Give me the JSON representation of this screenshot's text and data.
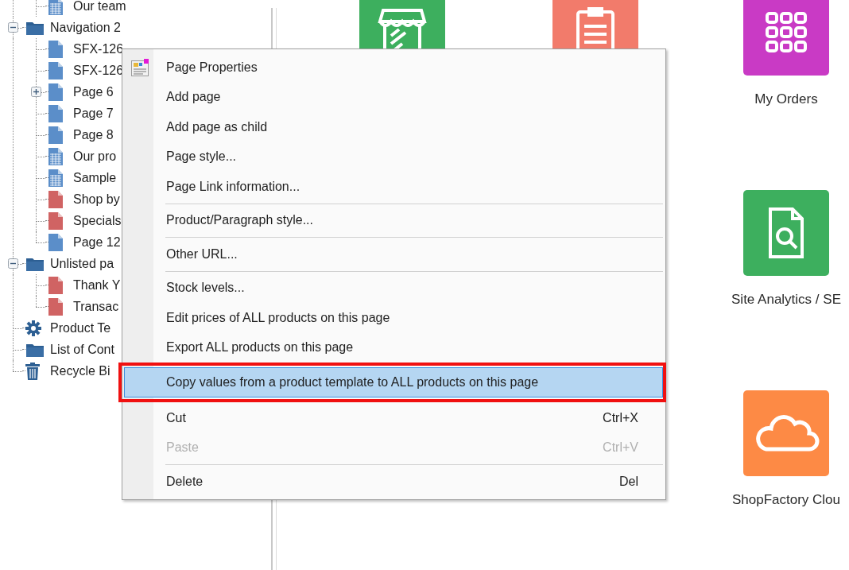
{
  "tree_continued": [
    {
      "label": "Our team",
      "kind": "grid-page"
    }
  ],
  "tree": [
    {
      "label": "Navigation 2",
      "kind": "folder",
      "expanded": true,
      "children": [
        {
          "label": "SFX-126",
          "kind": "page"
        },
        {
          "label": "SFX-126",
          "kind": "page"
        },
        {
          "label": "Page 6",
          "kind": "page",
          "expanded": false
        },
        {
          "label": "Page 7",
          "kind": "page"
        },
        {
          "label": "Page 8",
          "kind": "page"
        },
        {
          "label": "Our pro",
          "kind": "grid-page"
        },
        {
          "label": "Sample",
          "kind": "grid-page"
        },
        {
          "label": "Shop by",
          "kind": "red-page"
        },
        {
          "label": "Specials",
          "kind": "red-page"
        },
        {
          "label": "Page 12",
          "kind": "page"
        }
      ]
    },
    {
      "label": "Unlisted pa",
      "kind": "folder",
      "expanded": true,
      "children": [
        {
          "label": "Thank Y",
          "kind": "red-page"
        },
        {
          "label": "Transac",
          "kind": "red-page"
        }
      ]
    },
    {
      "label": "Product Te",
      "kind": "gear"
    },
    {
      "label": "List of Cont",
      "kind": "folder"
    },
    {
      "label": "Recycle Bi",
      "kind": "trash"
    }
  ],
  "dashboard": {
    "rows": [
      [
        {
          "kind": "tile",
          "color": "#3daf5e"
        },
        {
          "kind": "tile",
          "color": "#f27b6b"
        },
        {
          "kind": "tile",
          "color": "#c93ac5",
          "label": "My Orders"
        }
      ],
      [
        {
          "kind": "covered"
        },
        {
          "kind": "covered"
        },
        {
          "kind": "tile",
          "color": "#3daf5e",
          "label": "Site Analytics / SE"
        }
      ],
      [
        {
          "kind": "covered"
        },
        {
          "kind": "covered"
        },
        {
          "kind": "tile",
          "color": "#fd8a45",
          "label": "ShopFactory Clou"
        }
      ]
    ]
  },
  "context_menu": {
    "items": [
      {
        "kind": "icon-item",
        "label": "Page Properties",
        "disabled": false,
        "selected": false,
        "annotated": false
      },
      {
        "kind": "item",
        "label": "Add page",
        "disabled": false,
        "selected": false,
        "annotated": false
      },
      {
        "kind": "item",
        "label": "Add page as child",
        "disabled": false,
        "selected": false,
        "annotated": false
      },
      {
        "kind": "item",
        "label": "Page style...",
        "disabled": false,
        "selected": false,
        "annotated": false
      },
      {
        "kind": "item",
        "label": "Page Link information...",
        "disabled": false,
        "selected": false,
        "annotated": false
      },
      {
        "kind": "separator"
      },
      {
        "kind": "item",
        "label": "Product/Paragraph style...",
        "disabled": false,
        "selected": false,
        "annotated": false
      },
      {
        "kind": "separator"
      },
      {
        "kind": "item",
        "label": "Other URL...",
        "disabled": false,
        "selected": false,
        "annotated": false
      },
      {
        "kind": "separator"
      },
      {
        "kind": "item",
        "label": "Stock levels...",
        "disabled": false,
        "selected": false,
        "annotated": false
      },
      {
        "kind": "item",
        "label": "Edit prices of ALL products on this page",
        "disabled": false,
        "selected": false,
        "annotated": false
      },
      {
        "kind": "item",
        "label": "Export ALL products on this page",
        "disabled": false,
        "selected": false,
        "annotated": false
      },
      {
        "kind": "item",
        "label": "Copy values from a product template to ALL products on this page",
        "disabled": false,
        "selected": true,
        "annotated": true
      },
      {
        "kind": "separator"
      },
      {
        "kind": "item",
        "label": "Cut",
        "shortcut": "Ctrl+X",
        "disabled": false,
        "selected": false,
        "annotated": false
      },
      {
        "kind": "item",
        "label": "Paste",
        "shortcut": "Ctrl+V",
        "disabled": true,
        "selected": false,
        "annotated": false
      },
      {
        "kind": "separator"
      },
      {
        "kind": "item",
        "label": "Delete",
        "shortcut": "Del",
        "disabled": false,
        "selected": false,
        "annotated": false
      }
    ]
  }
}
